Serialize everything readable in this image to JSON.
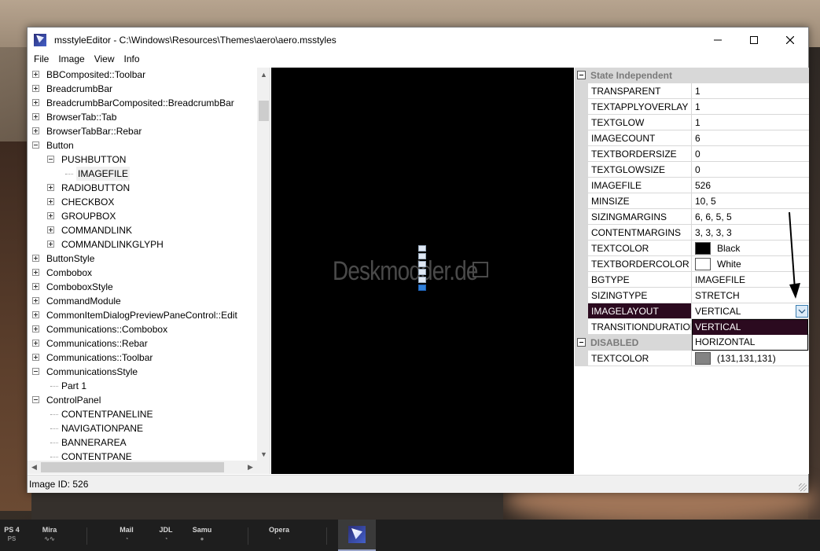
{
  "window": {
    "title": "msstyleEditor - C:\\Windows\\Resources\\Themes\\aero\\aero.msstyles",
    "minimize": "—",
    "maximize": "☐",
    "close": "✕"
  },
  "menu": [
    "File",
    "Image",
    "View",
    "Info"
  ],
  "tree": {
    "items": [
      {
        "label": "BBComposited::Toolbar",
        "level": 0,
        "expander": "plus"
      },
      {
        "label": "BreadcrumbBar",
        "level": 0,
        "expander": "plus"
      },
      {
        "label": "BreadcrumbBarComposited::BreadcrumbBar",
        "level": 0,
        "expander": "plus"
      },
      {
        "label": "BrowserTab::Tab",
        "level": 0,
        "expander": "plus"
      },
      {
        "label": "BrowserTabBar::Rebar",
        "level": 0,
        "expander": "plus"
      },
      {
        "label": "Button",
        "level": 0,
        "expander": "minus"
      },
      {
        "label": "PUSHBUTTON",
        "level": 1,
        "expander": "minus"
      },
      {
        "label": "IMAGEFILE",
        "level": 2,
        "expander": "none",
        "selected": true
      },
      {
        "label": "RADIOBUTTON",
        "level": 1,
        "expander": "plus"
      },
      {
        "label": "CHECKBOX",
        "level": 1,
        "expander": "plus"
      },
      {
        "label": "GROUPBOX",
        "level": 1,
        "expander": "plus"
      },
      {
        "label": "COMMANDLINK",
        "level": 1,
        "expander": "plus"
      },
      {
        "label": "COMMANDLINKGLYPH",
        "level": 1,
        "expander": "plus"
      },
      {
        "label": "ButtonStyle",
        "level": 0,
        "expander": "plus"
      },
      {
        "label": "Combobox",
        "level": 0,
        "expander": "plus"
      },
      {
        "label": "ComboboxStyle",
        "level": 0,
        "expander": "plus"
      },
      {
        "label": "CommandModule",
        "level": 0,
        "expander": "plus"
      },
      {
        "label": "CommonItemDialogPreviewPaneControl::Edit",
        "level": 0,
        "expander": "plus"
      },
      {
        "label": "Communications::Combobox",
        "level": 0,
        "expander": "plus"
      },
      {
        "label": "Communications::Rebar",
        "level": 0,
        "expander": "plus"
      },
      {
        "label": "Communications::Toolbar",
        "level": 0,
        "expander": "plus"
      },
      {
        "label": "CommunicationsStyle",
        "level": 0,
        "expander": "minus"
      },
      {
        "label": "Part 1",
        "level": 1,
        "expander": "none"
      },
      {
        "label": "ControlPanel",
        "level": 0,
        "expander": "minus"
      },
      {
        "label": "CONTENTPANELINE",
        "level": 1,
        "expander": "none"
      },
      {
        "label": "NAVIGATIONPANE",
        "level": 1,
        "expander": "none"
      },
      {
        "label": "BANNERAREA",
        "level": 1,
        "expander": "none"
      },
      {
        "label": "CONTENTPANE",
        "level": 1,
        "expander": "none"
      }
    ]
  },
  "preview": {
    "watermark": "Deskmodder.de",
    "image_count": 6,
    "active_frame": 5
  },
  "properties": {
    "category_state_independent": "State Independent",
    "rows": [
      {
        "name": "TRANSPARENT",
        "value": "1"
      },
      {
        "name": "TEXTAPPLYOVERLAY",
        "value": "1"
      },
      {
        "name": "TEXTGLOW",
        "value": "1"
      },
      {
        "name": "IMAGECOUNT",
        "value": "6"
      },
      {
        "name": "TEXTBORDERSIZE",
        "value": "0"
      },
      {
        "name": "TEXTGLOWSIZE",
        "value": "0"
      },
      {
        "name": "IMAGEFILE",
        "value": "526"
      },
      {
        "name": "MINSIZE",
        "value": "10, 5"
      },
      {
        "name": "SIZINGMARGINS",
        "value": "6, 6, 5, 5"
      },
      {
        "name": "CONTENTMARGINS",
        "value": "3, 3, 3, 3"
      },
      {
        "name": "TEXTCOLOR",
        "value": "Black",
        "color": "#000000"
      },
      {
        "name": "TEXTBORDERCOLOR",
        "value": "White",
        "color": "#ffffff"
      },
      {
        "name": "BGTYPE",
        "value": "IMAGEFILE"
      },
      {
        "name": "SIZINGTYPE",
        "value": "STRETCH"
      },
      {
        "name": "IMAGELAYOUT",
        "value": "VERTICAL",
        "selected": true
      },
      {
        "name": "TRANSITIONDURATION",
        "value": ""
      }
    ],
    "category_disabled": "DISABLED",
    "disabled_rows": [
      {
        "name": "TEXTCOLOR",
        "value": "(131,131,131)",
        "color": "#838383"
      }
    ],
    "dropdown_options": [
      "VERTICAL",
      "HORIZONTAL"
    ],
    "dropdown_selected": "VERTICAL"
  },
  "status": {
    "text": "Image ID: 526"
  },
  "taskbar": {
    "items": [
      {
        "label": "PS 4",
        "sub": "PS"
      },
      {
        "label": "Mira",
        "sub": "∿∿"
      },
      {
        "label": "Mail",
        "sub": "◔"
      },
      {
        "label": "JDL",
        "sub": "◔"
      },
      {
        "label": "Samu",
        "sub": "●"
      },
      {
        "label": "Opera",
        "sub": "◔"
      }
    ]
  },
  "colors": {
    "selection_dark": "#2b0a1f",
    "grid_line": "#d8d8d8",
    "category_text": "#7a7a7a"
  }
}
